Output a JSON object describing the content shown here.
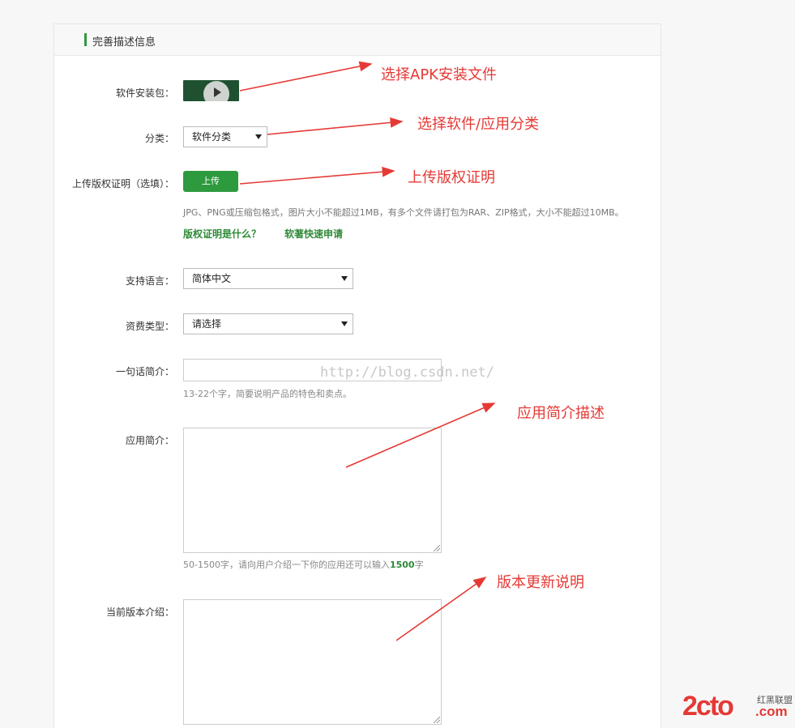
{
  "panel": {
    "title": "完善描述信息"
  },
  "form": {
    "apk_label": "软件安装包：",
    "category_label": "分类：",
    "category_value": "软件分类",
    "copyright_label": "上传版权证明（选填）：",
    "upload_button": "上传",
    "upload_hint": "JPG、PNG或压缩包格式，图片大小不能超过1MB，有多个文件请打包为RAR、ZIP格式，大小不能超过10MB。",
    "link_what": "版权证明是什么？",
    "link_apply": "软著快速申请",
    "language_label": "支持语言：",
    "language_value": "简体中文",
    "fee_label": "资费类型：",
    "fee_value": "请选择",
    "oneline_label": "一句话简介：",
    "oneline_hint": "13-22个字，简要说明产品的特色和卖点。",
    "intro_label": "应用简介：",
    "intro_hint_prefix": "50-1500字，请向用户介绍一下你的应用还可以输入",
    "intro_hint_count": "1500",
    "intro_hint_suffix": "字",
    "version_label": "当前版本介绍："
  },
  "annotations": {
    "apk": "选择APK安装文件",
    "category": "选择软件/应用分类",
    "copyright": "上传版权证明",
    "intro": "应用简介描述",
    "version": "版本更新说明"
  },
  "watermark": "http://blog.csdn.net/",
  "logo": {
    "main": "2cto",
    "sub": "红黑联盟",
    "domain": ".com"
  },
  "colors": {
    "accent": "#2e9a3e",
    "annotation": "#e53935"
  }
}
